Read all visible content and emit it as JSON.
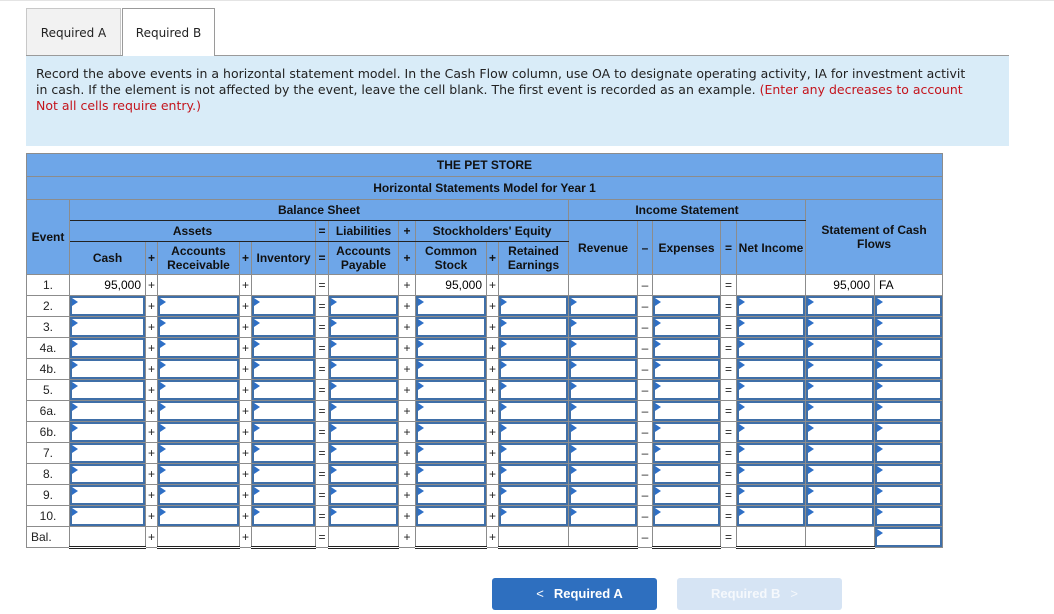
{
  "tabs": [
    {
      "label": "Required A",
      "active": false
    },
    {
      "label": "Required B",
      "active": true
    }
  ],
  "instructions": {
    "line1": "Record the above events in a horizontal statement model. In the Cash Flow column, use OA to designate operating activity, IA for investment activit",
    "line2_black": "in cash. If the element is not affected by the event, leave the cell blank. The first event is recorded as an example. ",
    "line2_red": "(Enter any decreases to account",
    "line3_red": "Not all cells require entry.)"
  },
  "table": {
    "title": "THE PET STORE",
    "subtitle": "Horizontal Statements Model for Year 1",
    "headers": {
      "event": "Event",
      "balance_sheet": "Balance Sheet",
      "income_statement": "Income Statement",
      "cash_flows": "Statement of Cash Flows",
      "assets": "Assets",
      "liabilities": "Liabilities",
      "stockholders_equity": "Stockholders' Equity",
      "cash": "Cash",
      "accounts_receivable": "Accounts Receivable",
      "inventory": "Inventory",
      "accounts_payable": "Accounts Payable",
      "common_stock": "Common Stock",
      "retained_earnings": "Retained Earnings",
      "revenue": "Revenue",
      "expenses": "Expenses",
      "net_income": "Net Income"
    },
    "operators": {
      "plus": "+",
      "equals": "=",
      "minus": "–"
    },
    "example_row": {
      "event": "1.",
      "cash": "95,000",
      "accounts_receivable": "",
      "inventory": "",
      "accounts_payable": "",
      "common_stock": "95,000",
      "retained_earnings": "",
      "revenue": "",
      "expenses": "",
      "net_income": "",
      "cash_flow_amount": "95,000",
      "cash_flow_activity": "FA"
    },
    "input_rows": [
      "2.",
      "3.",
      "4a.",
      "4b.",
      "5.",
      "6a.",
      "6b.",
      "7.",
      "8.",
      "9.",
      "10."
    ],
    "balance_row_label": "Bal."
  },
  "nav": {
    "prev_label": "Required A",
    "next_label": "Required B",
    "prev_chevron": "<",
    "next_chevron": ">"
  }
}
